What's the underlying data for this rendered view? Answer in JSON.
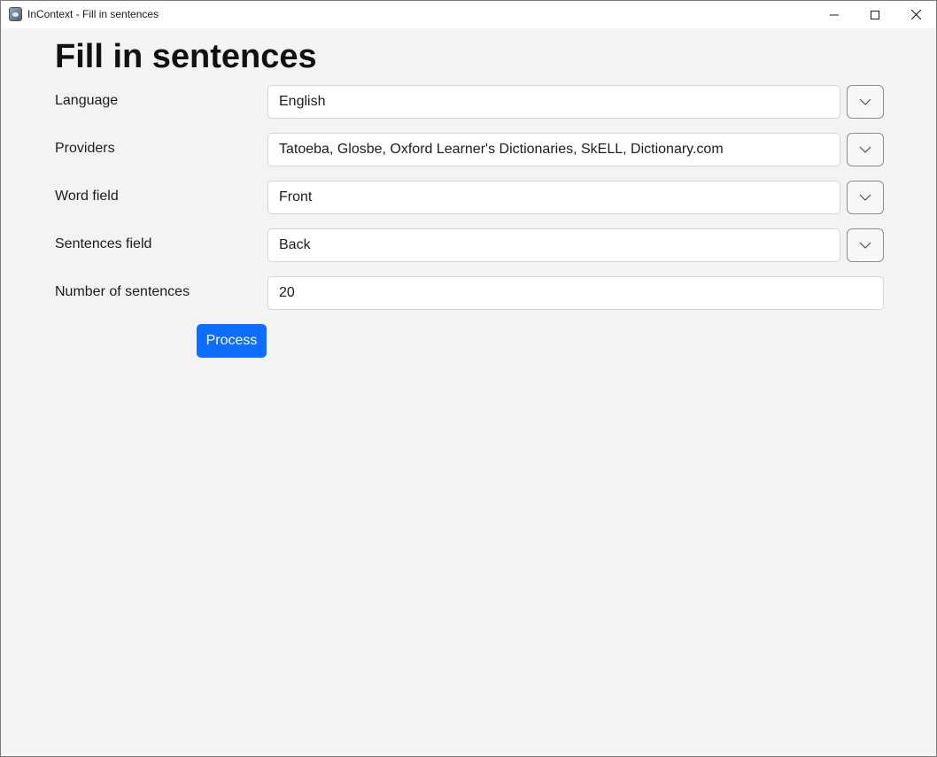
{
  "window": {
    "title": "InContext - Fill in sentences"
  },
  "page": {
    "heading": "Fill in sentences"
  },
  "form": {
    "language": {
      "label": "Language",
      "value": "English"
    },
    "providers": {
      "label": "Providers",
      "value": "Tatoeba, Glosbe, Oxford Learner's Dictionaries, SkELL, Dictionary.com"
    },
    "word_field": {
      "label": "Word field",
      "value": "Front"
    },
    "sentences_field": {
      "label": "Sentences field",
      "value": "Back"
    },
    "number_of_sentences": {
      "label": "Number of sentences",
      "value": "20"
    }
  },
  "actions": {
    "process_label": "Process"
  },
  "colors": {
    "accent": "#0d6efd",
    "background": "#f3f3f3"
  },
  "icons": {
    "minimize": "minimize-icon",
    "maximize": "maximize-icon",
    "close": "close-icon",
    "dropdown": "chevron-down-icon"
  }
}
